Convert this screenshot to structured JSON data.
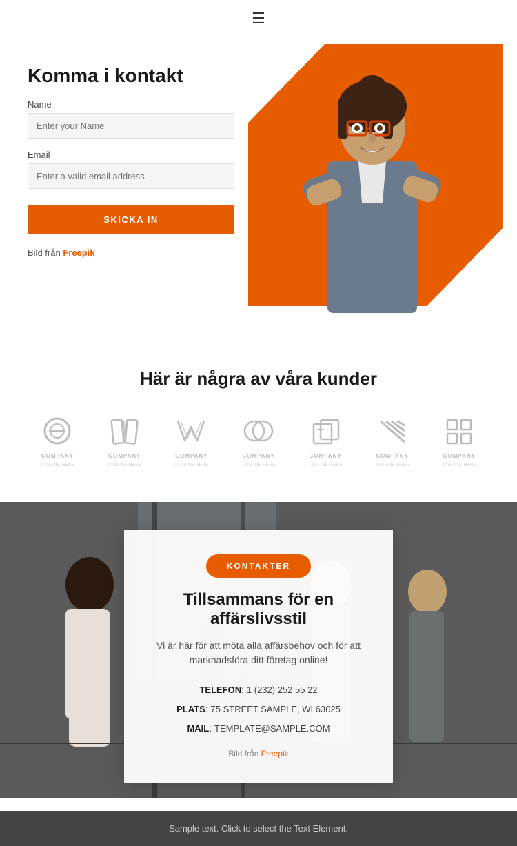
{
  "header": {
    "menu_icon": "☰"
  },
  "hero": {
    "title": "Komma i kontakt",
    "name_label": "Name",
    "name_placeholder": "Enter your Name",
    "email_label": "Email",
    "email_placeholder": "Enter a valid email address",
    "submit_label": "SKICKA IN",
    "credit_text": "Bild från",
    "credit_link": "Freepik"
  },
  "clients": {
    "heading": "Här är några av våra kunder",
    "logos": [
      {
        "name": "COMPANY",
        "tagline": "TAGLINE HERE"
      },
      {
        "name": "COMPANY",
        "tagline": "TAGLINE HERE"
      },
      {
        "name": "COMPANY",
        "tagline": "TAGLINE HERE"
      },
      {
        "name": "COMPANY",
        "tagline": "TAGLINE HERE"
      },
      {
        "name": "COMPANY",
        "tagline": "TAGLINE HERE"
      },
      {
        "name": "COMPANY",
        "tagline": "TAGLINE HERE"
      },
      {
        "name": "COMPANY",
        "tagline": "TAGLINE HERE"
      }
    ]
  },
  "contact": {
    "button_label": "KONTAKTER",
    "heading": "Tillsammans för en affärslivsstil",
    "description": "Vi är här för att möta alla affärsbehov och för att marknadsföra ditt företag online!",
    "phone_label": "TELEFON",
    "phone_value": "1 (232) 252 55 22",
    "address_label": "PLATS",
    "address_value": "75 STREET SAMPLE, WI 63025",
    "email_label": "MAIL",
    "email_value": "TEMPLATE@SAMPLE.COM",
    "credit_text": "Bild från",
    "credit_link": "Freepik"
  },
  "footer": {
    "text": "Sample text. Click to select the Text Element."
  }
}
